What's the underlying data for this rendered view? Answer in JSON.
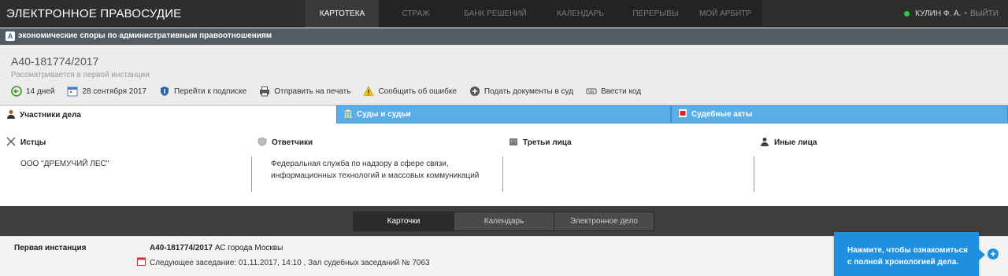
{
  "header": {
    "brand": "ЭЛЕКТРОННОЕ ПРАВОСУДИЕ",
    "nav": [
      {
        "label": "КАРТОТЕКА",
        "active": true
      },
      {
        "label": "СТРАЖ",
        "active": false
      },
      {
        "label": "БАНК РЕШЕНИЙ",
        "active": false
      },
      {
        "label": "КАЛЕНДАРЬ",
        "active": false
      },
      {
        "label": "ПЕРЕРЫВЫ",
        "active": false
      },
      {
        "label": "МОЙ АРБИТР",
        "active": false
      }
    ],
    "user_name": "КУЛИН Ф. А.",
    "separator": "•",
    "logout": "ВЫЙТИ",
    "status_color": "#2ecc40"
  },
  "category": {
    "icon": "document-icon",
    "label": "экономические споры по административным правоотношениям"
  },
  "case": {
    "number": "А40-181774/2017",
    "status": "Рассматривается в первой инстанции",
    "actions": [
      {
        "icon": "back-arrow-icon",
        "label": "14 дней"
      },
      {
        "icon": "calendar-icon",
        "label": "28 сентября 2017"
      },
      {
        "icon": "shield-icon",
        "label": "Перейти к подписке"
      },
      {
        "icon": "printer-icon",
        "label": "Отправить на печать"
      },
      {
        "icon": "warning-icon",
        "label": "Сообщить об ошибке"
      },
      {
        "icon": "plus-circle-icon",
        "label": "Подать документы в суд"
      },
      {
        "icon": "keyboard-icon",
        "label": "Ввести код"
      }
    ]
  },
  "tabs": [
    {
      "label": "Участники дела",
      "icon": "person-icon",
      "active": true
    },
    {
      "label": "Суды и судьи",
      "icon": "courthouse-icon",
      "active": false
    },
    {
      "label": "Судебные акты",
      "icon": "pdf-icon",
      "active": false
    }
  ],
  "parties": {
    "plaintiffs": {
      "title": "Истцы",
      "icon": "swords-icon",
      "items": [
        "ООО \"ДРЕМУЧИЙ ЛЕС\""
      ]
    },
    "defendants": {
      "title": "Ответчики",
      "icon": "shield-icon",
      "items": [
        "Федеральная служба по надзору в сфере связи,",
        "информационных технологий и массовых коммуникаций"
      ]
    },
    "third_parties": {
      "title": "Третьи лица",
      "icon": "building-icon",
      "items": []
    },
    "other_parties": {
      "title": "Иные лица",
      "icon": "person-icon",
      "items": []
    }
  },
  "view_switch": [
    {
      "label": "Карточки",
      "active": true
    },
    {
      "label": "Календарь",
      "active": false
    },
    {
      "label": "Электронное дело",
      "active": false
    }
  ],
  "instance": {
    "label": "Первая инстанция",
    "case_number": "А40-181774/2017",
    "court": "АС города Москвы",
    "next_hearing": "Следующее заседание: 01.11.2017, 14:10 , Зал судебных заседаний № 7063"
  },
  "tooltip": {
    "line1": "Нажмите, чтобы ознакомиться",
    "line2": "с полной хронологией дела.",
    "color": "#1f8fe0"
  }
}
